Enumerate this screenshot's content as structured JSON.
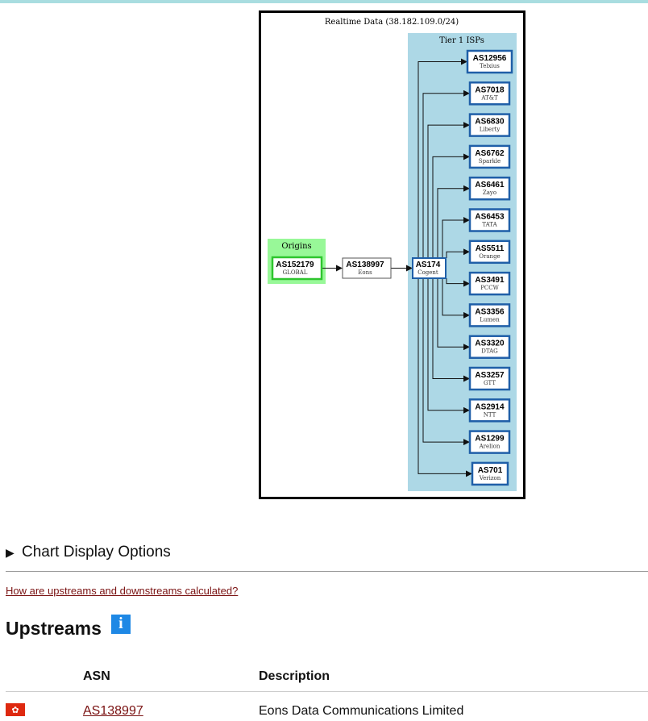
{
  "graph": {
    "title": "Realtime Data (38.182.109.0/24)",
    "origins_label": "Origins",
    "tier1_label": "Tier 1 ISPs",
    "origin": {
      "asn": "AS152179",
      "name": "GLOBAL"
    },
    "upstream": {
      "asn": "AS138997",
      "name": "Eons"
    },
    "transit": {
      "asn": "AS174",
      "name": "Cogent"
    },
    "tier1": [
      {
        "asn": "AS12956",
        "name": "Telxius"
      },
      {
        "asn": "AS7018",
        "name": "AT&T"
      },
      {
        "asn": "AS6830",
        "name": "Liberty"
      },
      {
        "asn": "AS6762",
        "name": "Sparkle"
      },
      {
        "asn": "AS6461",
        "name": "Zayo"
      },
      {
        "asn": "AS6453",
        "name": "TATA"
      },
      {
        "asn": "AS5511",
        "name": "Orange"
      },
      {
        "asn": "AS3491",
        "name": "PCCW"
      },
      {
        "asn": "AS3356",
        "name": "Lumen"
      },
      {
        "asn": "AS3320",
        "name": "DTAG"
      },
      {
        "asn": "AS3257",
        "name": "GTT"
      },
      {
        "asn": "AS2914",
        "name": "NTT"
      },
      {
        "asn": "AS1299",
        "name": "Arelion"
      },
      {
        "asn": "AS701",
        "name": "Verizon"
      }
    ],
    "colors": {
      "origins_bg": "#98f898",
      "origin_border": "#2ec52e",
      "tier1_bg": "#add8e6",
      "tier1_border": "#1f5fa8"
    }
  },
  "options": {
    "summary": "Chart Display Options"
  },
  "help_link": "How are upstreams and downstreams calculated?",
  "upstreams": {
    "title": "Upstreams",
    "info_icon": "i",
    "columns": {
      "asn": "ASN",
      "description": "Description"
    },
    "rows": [
      {
        "flag": "hk-flag-icon",
        "asn": "AS138997",
        "description": "Eons Data Communications Limited"
      }
    ]
  }
}
